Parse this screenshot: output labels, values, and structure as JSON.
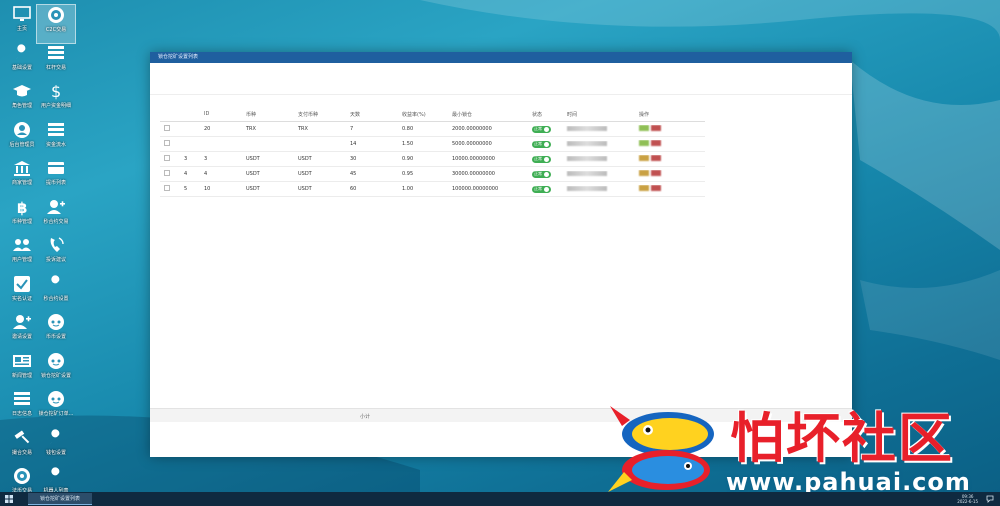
{
  "desktop": {
    "icons": [
      {
        "label": "主页",
        "icon": "monitor-icon"
      },
      {
        "label": "C2C交易",
        "icon": "c2c-icon"
      },
      {
        "label": "基础设置",
        "icon": "wrench-icon"
      },
      {
        "label": "杠杆交易",
        "icon": "list-icon"
      },
      {
        "label": "角色管理",
        "icon": "graduation-cap-icon"
      },
      {
        "label": "用户资金明细",
        "icon": "dollar-icon"
      },
      {
        "label": "后台管理员",
        "icon": "user-circle-icon"
      },
      {
        "label": "资金流水",
        "icon": "list-icon"
      },
      {
        "label": "商家管理",
        "icon": "bank-icon"
      },
      {
        "label": "提币列表",
        "icon": "card-icon"
      },
      {
        "label": "币种管理",
        "icon": "bitcoin-icon"
      },
      {
        "label": "秒合约交易",
        "icon": "user-plus-icon"
      },
      {
        "label": "用户管理",
        "icon": "users-icon"
      },
      {
        "label": "投诉建议",
        "icon": "phone-icon"
      },
      {
        "label": "实名认证",
        "icon": "checkbox-icon"
      },
      {
        "label": "秒合约设置",
        "icon": "wrench-icon"
      },
      {
        "label": "邀请设置",
        "icon": "user-plus-icon"
      },
      {
        "label": "币币设置",
        "icon": "reddit-icon"
      },
      {
        "label": "新闻管理",
        "icon": "newspaper-icon"
      },
      {
        "label": "锁仓挖矿设置",
        "icon": "reddit-icon"
      },
      {
        "label": "日志信息",
        "icon": "list-icon"
      },
      {
        "label": "锁仓挖矿订单...",
        "icon": "reddit-icon"
      },
      {
        "label": "撮合交易",
        "icon": "gavel-icon"
      },
      {
        "label": "钱包设置",
        "icon": "wrench-icon"
      },
      {
        "label": "法币交易",
        "icon": "c2c-icon"
      },
      {
        "label": "机器人列表",
        "icon": "wrench-icon"
      }
    ]
  },
  "window": {
    "title": "锁仓挖矿设置列表",
    "columns": [
      "",
      "",
      "ID",
      "币种",
      "支付币种",
      "天数",
      "收益率(%)",
      "最小锁仓",
      "状态",
      "时间",
      "操作"
    ],
    "rows": [
      {
        "idx": "",
        "id": "20",
        "currency": "TRX",
        "pay": "TRX",
        "days": "7",
        "rate": "0.80",
        "min": "2000.00000000",
        "status": "正常"
      },
      {
        "idx": "",
        "id": "",
        "currency": "",
        "pay": "",
        "days": "14",
        "rate": "1.50",
        "min": "5000.00000000",
        "status": "正常"
      },
      {
        "idx": "3",
        "id": "3",
        "currency": "USDT",
        "pay": "USDT",
        "days": "30",
        "rate": "0.90",
        "min": "10000.00000000",
        "status": "正常"
      },
      {
        "idx": "4",
        "id": "4",
        "currency": "USDT",
        "pay": "USDT",
        "days": "45",
        "rate": "0.95",
        "min": "30000.00000000",
        "status": "正常"
      },
      {
        "idx": "5",
        "id": "10",
        "currency": "USDT",
        "pay": "USDT",
        "days": "60",
        "rate": "1.00",
        "min": "100000.00000000",
        "status": "正常"
      }
    ],
    "summary_label": "小计"
  },
  "watermark": {
    "title": "怕坏社区",
    "url": "www.pahuai.com"
  },
  "taskbar": {
    "active_window": "锁仓挖矿设置列表",
    "time": "09:36",
    "date": "2022-6-15"
  },
  "colors": {
    "titlebar": "#1f5f9f",
    "status_green": "#3fae54",
    "logo_red": "#e8202a",
    "taskbar": "#0f2a40"
  }
}
